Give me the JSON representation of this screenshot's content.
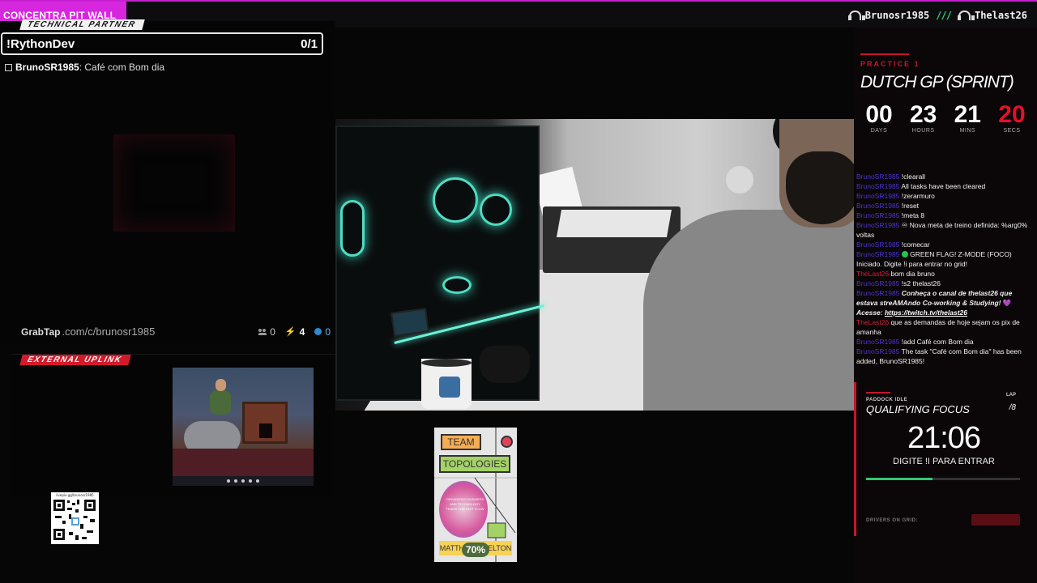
{
  "topbar": {
    "brand": "CONCENTRA PIT WALL",
    "host1": "Brunosr1985",
    "separator": "///",
    "host2": "Thelast26"
  },
  "technical_partner": {
    "tag": "TECHNICAL PARTNER",
    "task_title": "!RythonDev",
    "task_count": "0/1",
    "task_user": "BrunoSR1985",
    "task_text": ": Café com Bom dia",
    "footer_logo": "GrabTap",
    "footer_url": ".com/c/brunosr1985",
    "stat_users": "0",
    "stat_bolt": "4",
    "stat_play": "0"
  },
  "external_uplink": {
    "tag": "EXTERNAL UPLINK"
  },
  "qr": {
    "url": "livepix.gg/brunosr1985"
  },
  "book": {
    "title1": "TEAM",
    "title2": "TOPOLOGIES",
    "subtitle": "ORGANIZING BUSINESS AND TECHNOLOGY TEAMS FOR FAST FLOW",
    "authors": "MATTHEW SKELTON",
    "progress_label": "70%",
    "colors": {
      "team": "#f5ad54",
      "topologies": "#a4d266",
      "dot": "#e0445a"
    }
  },
  "race": {
    "session": "PRACTICE 1",
    "title": "DUTCH GP (SPRINT)",
    "countdown": [
      {
        "value": "00",
        "label": "DAYS"
      },
      {
        "value": "23",
        "label": "HOURS"
      },
      {
        "value": "21",
        "label": "MINS"
      },
      {
        "value": "20",
        "label": "SECS"
      }
    ]
  },
  "chat": [
    {
      "user": "BrunoSR1985",
      "text": "!clearall"
    },
    {
      "user": "BrunoSR1985",
      "text": "All tasks have been cleared"
    },
    {
      "user": "BrunoSR1985",
      "text": "!zerarmuro"
    },
    {
      "user": "BrunoSR1985",
      "text": "!reset"
    },
    {
      "user": "BrunoSR1985",
      "text": "!meta 8"
    },
    {
      "user": "BrunoSR1985",
      "text": "♾ Nova meta de treino definida: %arg0% voltas"
    },
    {
      "user": "BrunoSR1985",
      "text": "!comecar"
    },
    {
      "user": "BrunoSR1985",
      "text": "GREEN FLAG! Z-MODE (FOCO) Iniciado. Digite !i para entrar no grid!"
    },
    {
      "user": "TheLast26",
      "text": "bom dia bruno"
    },
    {
      "user": "BrunoSR1985",
      "text": "!s2 thelast26"
    },
    {
      "user": "BrunoSR1985",
      "text": "Conheça o canal de thelast26 que estava streAMAndo Co-working & Studying!"
    },
    {
      "user": "",
      "text": "Acesse: ",
      "link": "https://twitch.tv/thelast26"
    },
    {
      "user": "TheLast26",
      "text": "que as demandas de hoje sejam os pix de amanha"
    },
    {
      "user": "BrunoSR1985",
      "text": "!add Café com Bom dia"
    },
    {
      "user": "BrunoSR1985",
      "text": "The task \"Café com Bom dia\" has been added, BrunoSR1985!"
    }
  ],
  "focus": {
    "status": "PADDOCK IDLE",
    "lap_label": "LAP",
    "title": "QUALIFYING FOCUS",
    "lap_value": "/8",
    "timer": "21:06",
    "cta": "DIGITE !I PARA ENTRAR",
    "progress": 0.43,
    "drivers_label": "DRIVERS ON GRID:"
  },
  "colors": {
    "accent_magenta": "#d627de",
    "accent_red": "#c3172a",
    "green": "#31c871"
  }
}
